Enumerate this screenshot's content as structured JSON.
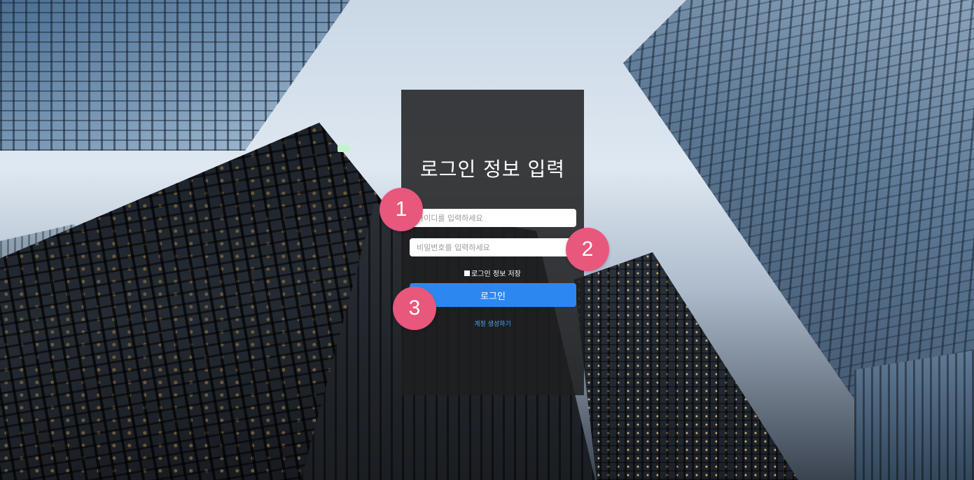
{
  "login": {
    "title": "로그인 정보 입력",
    "id_placeholder": "아이디를 입력하세요",
    "password_placeholder": "비밀번호를 입력하세요",
    "remember_label": "로그인 정보 저장",
    "login_button": "로그인",
    "signup_link": "계정 생성하기"
  },
  "markers": [
    "1",
    "2",
    "3"
  ],
  "colors": {
    "panel_bg": "#1e1e20",
    "button": "#2d87f0",
    "link": "#4aa3ff",
    "marker": "#e8577c"
  }
}
